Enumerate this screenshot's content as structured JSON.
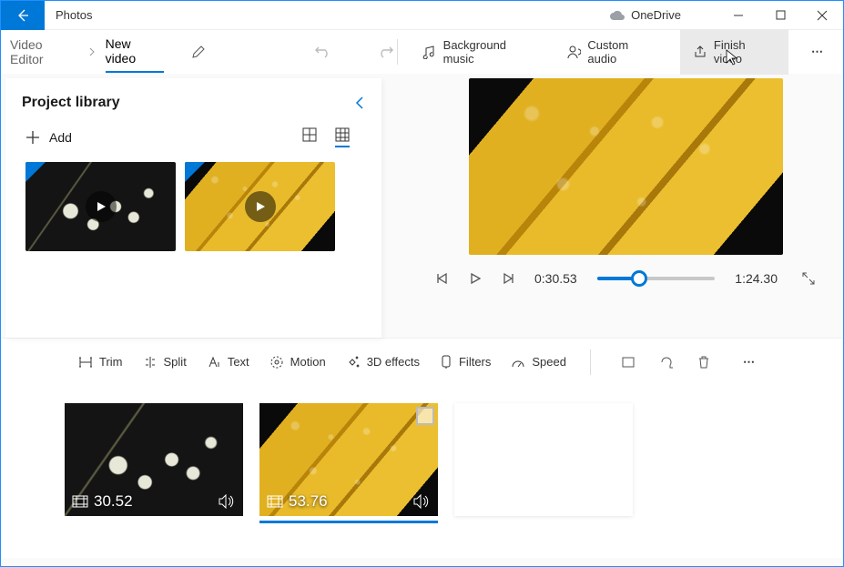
{
  "app": {
    "title": "Photos"
  },
  "titlebar": {
    "onedrive": "OneDrive"
  },
  "toolbar": {
    "breadcrumbs": {
      "root": "Video Editor",
      "current": "New video"
    },
    "bgmusic": "Background music",
    "customaudio": "Custom audio",
    "finish": "Finish video"
  },
  "library": {
    "title": "Project library",
    "add": "Add"
  },
  "playback": {
    "current": "0:30.53",
    "total": "1:24.30"
  },
  "storyboard": {
    "trim": "Trim",
    "split": "Split",
    "text": "Text",
    "motion": "Motion",
    "threed": "3D effects",
    "filters": "Filters",
    "speed": "Speed"
  },
  "clips": {
    "c1_duration": "30.52",
    "c2_duration": "53.76"
  }
}
